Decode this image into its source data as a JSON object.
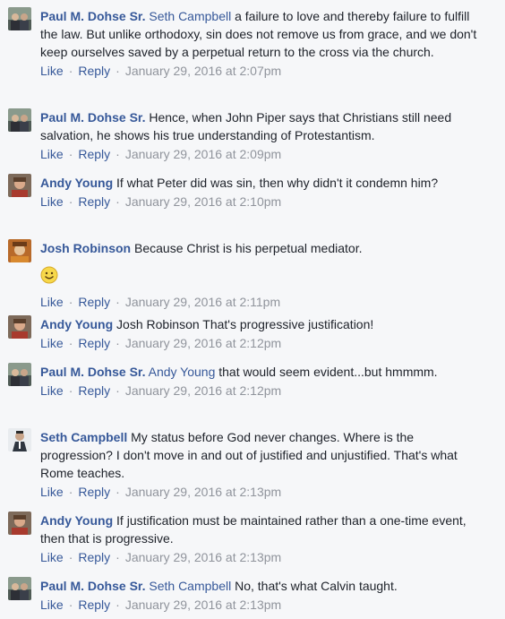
{
  "actions": {
    "like": "Like",
    "reply": "Reply",
    "sep": "·"
  },
  "comments": [
    {
      "author": "Paul M. Dohse Sr.",
      "mention": "Seth Campbell",
      "text": " a failure to love and thereby failure to fulfill the law. But unlike orthodoxy, sin does not remove us from grace, and we don't keep ourselves saved by a perpetual return to the cross via the church.",
      "time": "January 29, 2016 at 2:07pm",
      "avatar": "paul-avatar"
    },
    {
      "author": "Paul M. Dohse Sr.",
      "mention": "",
      "text": " Hence, when John Piper says that Christians still need salvation, he shows his true understanding of Protestantism.",
      "time": "January 29, 2016 at 2:09pm",
      "avatar": "paul-avatar"
    },
    {
      "author": "Andy Young",
      "mention": "",
      "text": " If what Peter did was sin, then why didn't it condemn him?",
      "time": "January 29, 2016 at 2:10pm",
      "avatar": "andy-avatar"
    },
    {
      "author": "Josh Robinson",
      "mention": "",
      "text": " Because Christ is his perpetual mediator.",
      "time": "January 29, 2016 at 2:11pm",
      "avatar": "josh-avatar",
      "emoji": "smiley-emoji"
    },
    {
      "author": "Andy Young",
      "mention": "",
      "text": " Josh Robinson That's progressive justification!",
      "time": "January 29, 2016 at 2:12pm",
      "avatar": "andy-avatar"
    },
    {
      "author": "Paul M. Dohse Sr.",
      "mention": "Andy Young",
      "text": " that would seem evident...but hmmmm.",
      "time": "January 29, 2016 at 2:12pm",
      "avatar": "paul-avatar"
    },
    {
      "author": "Seth Campbell",
      "mention": "",
      "text": " My status before God never changes. Where is the progression? I don't move in and out of justified and unjustified. That's what Rome teaches.",
      "time": "January 29, 2016 at 2:13pm",
      "avatar": "seth-avatar"
    },
    {
      "author": "Andy Young",
      "mention": "",
      "text": " If justification must be maintained rather than a one-time event, then that is progressive.",
      "time": "January 29, 2016 at 2:13pm",
      "avatar": "andy-avatar"
    },
    {
      "author": "Paul M. Dohse Sr.",
      "mention": "Seth Campbell",
      "text": " No, that's what Calvin taught.",
      "time": "January 29, 2016 at 2:13pm",
      "avatar": "paul-avatar"
    }
  ],
  "colors": {
    "link": "#365899",
    "meta": "#90949c",
    "text": "#1d2129",
    "background": "#f6f7f9"
  }
}
